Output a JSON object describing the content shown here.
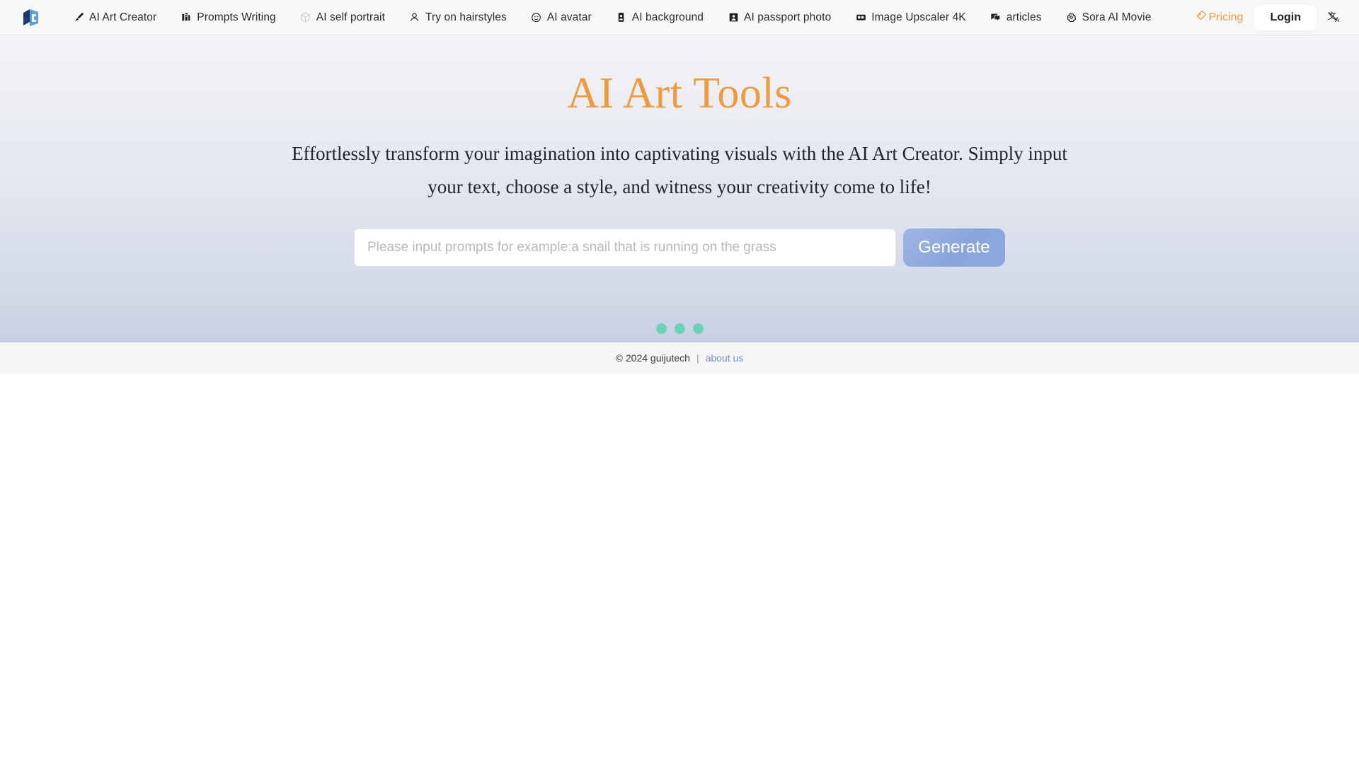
{
  "navbar": {
    "logo_name": "guijutech-logo",
    "items": [
      {
        "label": "AI Art Creator",
        "icon": "paintbrush-icon"
      },
      {
        "label": "Prompts Writing",
        "icon": "bar-chart-icon"
      },
      {
        "label": "AI self portrait",
        "icon": "cube-icon"
      },
      {
        "label": "Try on hairstyles",
        "icon": "person-hair-icon"
      },
      {
        "label": "AI avatar",
        "icon": "smiley-face-icon"
      },
      {
        "label": "AI background",
        "icon": "id-portrait-icon"
      },
      {
        "label": "AI passport photo",
        "icon": "passport-photo-icon"
      },
      {
        "label": "Image Upscaler 4K",
        "icon": "image-frame-icon"
      },
      {
        "label": "articles",
        "icon": "chat-bubble-icon"
      },
      {
        "label": "Sora AI Movie",
        "icon": "sora-flower-icon"
      }
    ],
    "pricing_label": "Pricing",
    "pricing_icon": "price-tag-icon",
    "pricing_color": "#f59a3c",
    "login_label": "Login",
    "language_icon": "language-translate-icon"
  },
  "hero": {
    "title": "AI Art Tools",
    "title_color": "#ef9a3d",
    "subtitle": "Effortlessly transform your imagination into captivating visuals with the AI Art Creator. Simply input your text, choose a style, and witness your creativity come to life!",
    "input_placeholder": "Please input prompts for example:a snail that is running on the grass",
    "input_value": "",
    "generate_label": "Generate",
    "generate_color": "#8aa5dd",
    "loader_dots": 3,
    "loader_color": "#6bd3b4"
  },
  "footer": {
    "copyright": "© 2024 guijutech",
    "separator": "|",
    "about_label": "about us",
    "about_color": "#6f93c9"
  }
}
